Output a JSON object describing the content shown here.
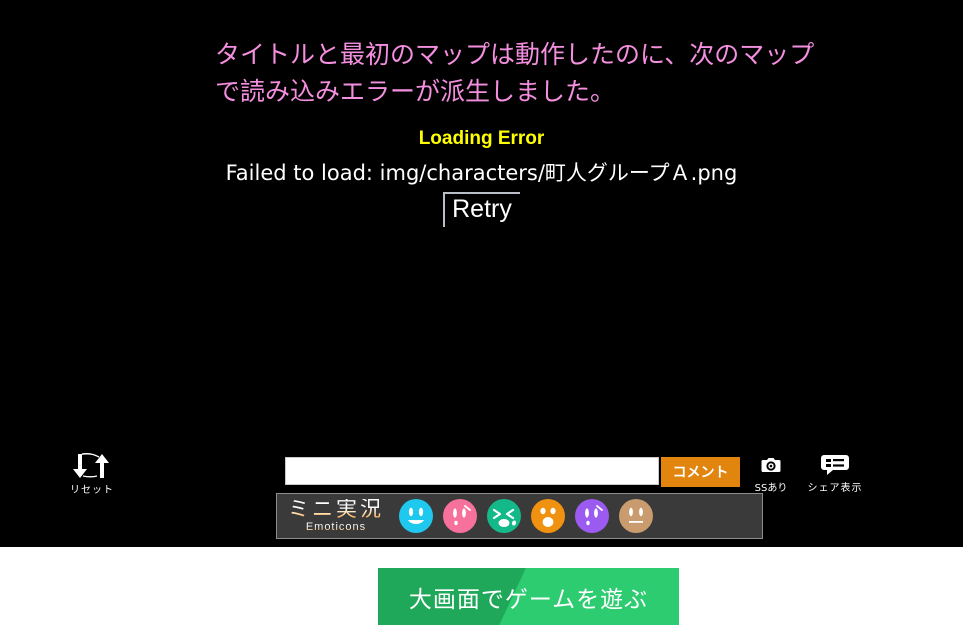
{
  "stage": {
    "background_color": "#000000",
    "notice": {
      "text": "タイトルと最初のマップは動作したのに、次のマップで読み込みエラーが派生しました。",
      "color": "#f48fe0"
    },
    "error": {
      "title": "Loading Error",
      "title_color": "#ffff00",
      "detail": "Failed to load: img/characters/町人グループＡ.png",
      "retry_label": "Retry"
    }
  },
  "controls": {
    "reset": {
      "label": "リセット",
      "icon": "reset-arrows-icon"
    },
    "comment": {
      "input_value": "",
      "input_placeholder": "",
      "button_label": "コメント",
      "button_color": "#e2850f"
    },
    "screenshot": {
      "label": "SSあり",
      "icon": "camera-icon"
    },
    "share": {
      "label": "シェア表示",
      "icon": "speech-bubble-icon"
    }
  },
  "emoticons": {
    "title_jp": "ミニ実況",
    "title_en": "Emoticons",
    "items": [
      {
        "name": "emoticon-smile",
        "color": "#1ec8ee",
        "face": "smile"
      },
      {
        "name": "emoticon-sweat-pink",
        "color": "#f7719d",
        "face": "sweat"
      },
      {
        "name": "emoticon-cry-green",
        "color": "#14b98a",
        "face": "cry"
      },
      {
        "name": "emoticon-shock-orange",
        "color": "#f0920f",
        "face": "shock"
      },
      {
        "name": "emoticon-sweat-purple",
        "color": "#9b5bf0",
        "face": "sweat"
      },
      {
        "name": "emoticon-neutral-tan",
        "color": "#c99b6e",
        "face": "neutral"
      }
    ]
  },
  "cta": {
    "label": "大画面でゲームを遊ぶ",
    "color": "#2ecc71"
  }
}
